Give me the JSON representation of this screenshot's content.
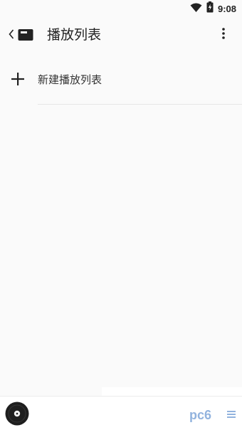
{
  "status_bar": {
    "time": "9:08",
    "icons": [
      "wifi-icon",
      "battery-charging-icon"
    ]
  },
  "app_bar": {
    "title": "播放列表",
    "back_icon": "chevron-left-icon",
    "folder_icon": "folder-icon",
    "menu_icon": "more-vertical-icon"
  },
  "list": {
    "new_playlist_label": "新建播放列表",
    "new_playlist_icon": "plus-icon"
  },
  "bottom_bar": {
    "now_playing_icon": "vinyl-disc-icon"
  },
  "watermark": {
    "text": "pc6"
  },
  "colors": {
    "background": "#fafafa",
    "text": "#222222",
    "divider": "#e6e6e6",
    "watermark": "#3a76c4"
  }
}
